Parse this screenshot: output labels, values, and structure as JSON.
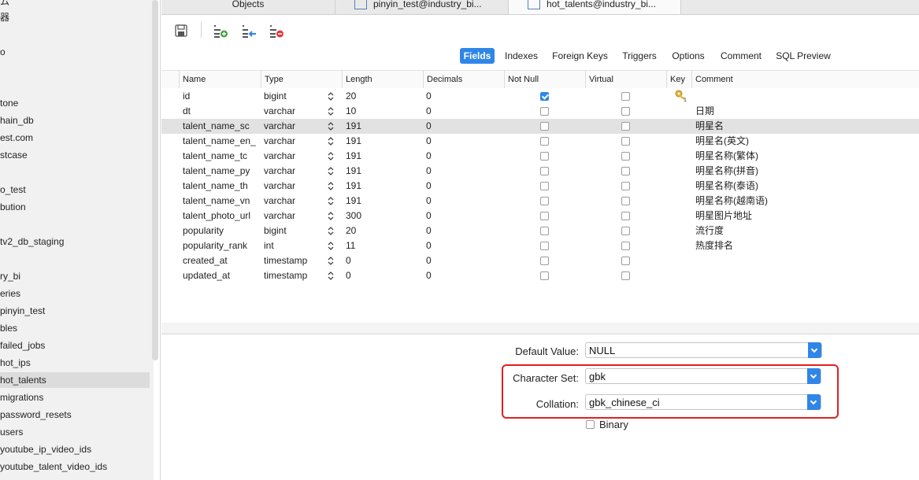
{
  "sidebar": {
    "items": [
      {
        "label": "ム",
        "selected": false
      },
      {
        "label": "器",
        "selected": false
      },
      {
        "label": "o",
        "selected": false
      },
      {
        "label": "tone",
        "selected": false
      },
      {
        "label": "hain_db",
        "selected": false
      },
      {
        "label": "est.com",
        "selected": false
      },
      {
        "label": "stcase",
        "selected": false
      },
      {
        "label": "o_test",
        "selected": false
      },
      {
        "label": "bution",
        "selected": false
      },
      {
        "label": "tv2_db_staging",
        "selected": false
      },
      {
        "label": "ry_bi",
        "selected": false
      },
      {
        "label": "eries",
        "selected": false
      },
      {
        "label": "pinyin_test",
        "selected": false
      },
      {
        "label": "bles",
        "selected": false
      },
      {
        "label": "failed_jobs",
        "selected": false
      },
      {
        "label": "hot_ips",
        "selected": false
      },
      {
        "label": "hot_talents",
        "selected": true
      },
      {
        "label": "migrations",
        "selected": false
      },
      {
        "label": "password_resets",
        "selected": false
      },
      {
        "label": "users",
        "selected": false
      },
      {
        "label": "youtube_ip_video_ids",
        "selected": false
      },
      {
        "label": "youtube_talent_video_ids",
        "selected": false
      }
    ]
  },
  "tabs": [
    {
      "label": "Objects"
    },
    {
      "label": "pinyin_test@industry_bi..."
    },
    {
      "label": "hot_talents@industry_bi..."
    }
  ],
  "toolbar": {
    "save": "save-icon",
    "add_field": "add-field-icon",
    "insert_field": "insert-field-icon",
    "delete_field": "delete-field-icon"
  },
  "subtabs": [
    {
      "label": "Fields",
      "active": true
    },
    {
      "label": "Indexes",
      "active": false
    },
    {
      "label": "Foreign Keys",
      "active": false
    },
    {
      "label": "Triggers",
      "active": false
    },
    {
      "label": "Options",
      "active": false
    },
    {
      "label": "Comment",
      "active": false
    },
    {
      "label": "SQL Preview",
      "active": false
    }
  ],
  "columns": [
    "Name",
    "Type",
    "Length",
    "Decimals",
    "Not Null",
    "Virtual",
    "Key",
    "Comment"
  ],
  "rows": [
    {
      "name": "id",
      "type": "bigint",
      "length": "20",
      "decimals": "0",
      "not_null": true,
      "virtual": false,
      "key": true,
      "comment": ""
    },
    {
      "name": "dt",
      "type": "varchar",
      "length": "10",
      "decimals": "0",
      "not_null": false,
      "virtual": false,
      "key": false,
      "comment": "日期"
    },
    {
      "name": "talent_name_sc",
      "type": "varchar",
      "length": "191",
      "decimals": "0",
      "not_null": false,
      "virtual": false,
      "key": false,
      "comment": "明星名",
      "selected": true
    },
    {
      "name": "talent_name_en_",
      "type": "varchar",
      "length": "191",
      "decimals": "0",
      "not_null": false,
      "virtual": false,
      "key": false,
      "comment": "明星名(英文)"
    },
    {
      "name": "talent_name_tc",
      "type": "varchar",
      "length": "191",
      "decimals": "0",
      "not_null": false,
      "virtual": false,
      "key": false,
      "comment": "明星名称(繁体)"
    },
    {
      "name": "talent_name_py",
      "type": "varchar",
      "length": "191",
      "decimals": "0",
      "not_null": false,
      "virtual": false,
      "key": false,
      "comment": "明星名称(拼音)"
    },
    {
      "name": "talent_name_th",
      "type": "varchar",
      "length": "191",
      "decimals": "0",
      "not_null": false,
      "virtual": false,
      "key": false,
      "comment": "明星名称(泰语)"
    },
    {
      "name": "talent_name_vn",
      "type": "varchar",
      "length": "191",
      "decimals": "0",
      "not_null": false,
      "virtual": false,
      "key": false,
      "comment": "明星名称(越南语)"
    },
    {
      "name": "talent_photo_url",
      "type": "varchar",
      "length": "300",
      "decimals": "0",
      "not_null": false,
      "virtual": false,
      "key": false,
      "comment": "明星图片地址"
    },
    {
      "name": "popularity",
      "type": "bigint",
      "length": "20",
      "decimals": "0",
      "not_null": false,
      "virtual": false,
      "key": false,
      "comment": "流行度"
    },
    {
      "name": "popularity_rank",
      "type": "int",
      "length": "11",
      "decimals": "0",
      "not_null": false,
      "virtual": false,
      "key": false,
      "comment": "热度排名"
    },
    {
      "name": "created_at",
      "type": "timestamp",
      "length": "0",
      "decimals": "0",
      "not_null": false,
      "virtual": false,
      "key": false,
      "comment": ""
    },
    {
      "name": "updated_at",
      "type": "timestamp",
      "length": "0",
      "decimals": "0",
      "not_null": false,
      "virtual": false,
      "key": false,
      "comment": ""
    }
  ],
  "properties": {
    "default_label": "Default Value:",
    "default_value": "NULL",
    "charset_label": "Character Set:",
    "charset_value": "gbk",
    "collation_label": "Collation:",
    "collation_value": "gbk_chinese_ci",
    "binary_label": "Binary",
    "binary_checked": false
  },
  "colors": {
    "accent": "#2f86e8",
    "highlight": "#e02020"
  }
}
